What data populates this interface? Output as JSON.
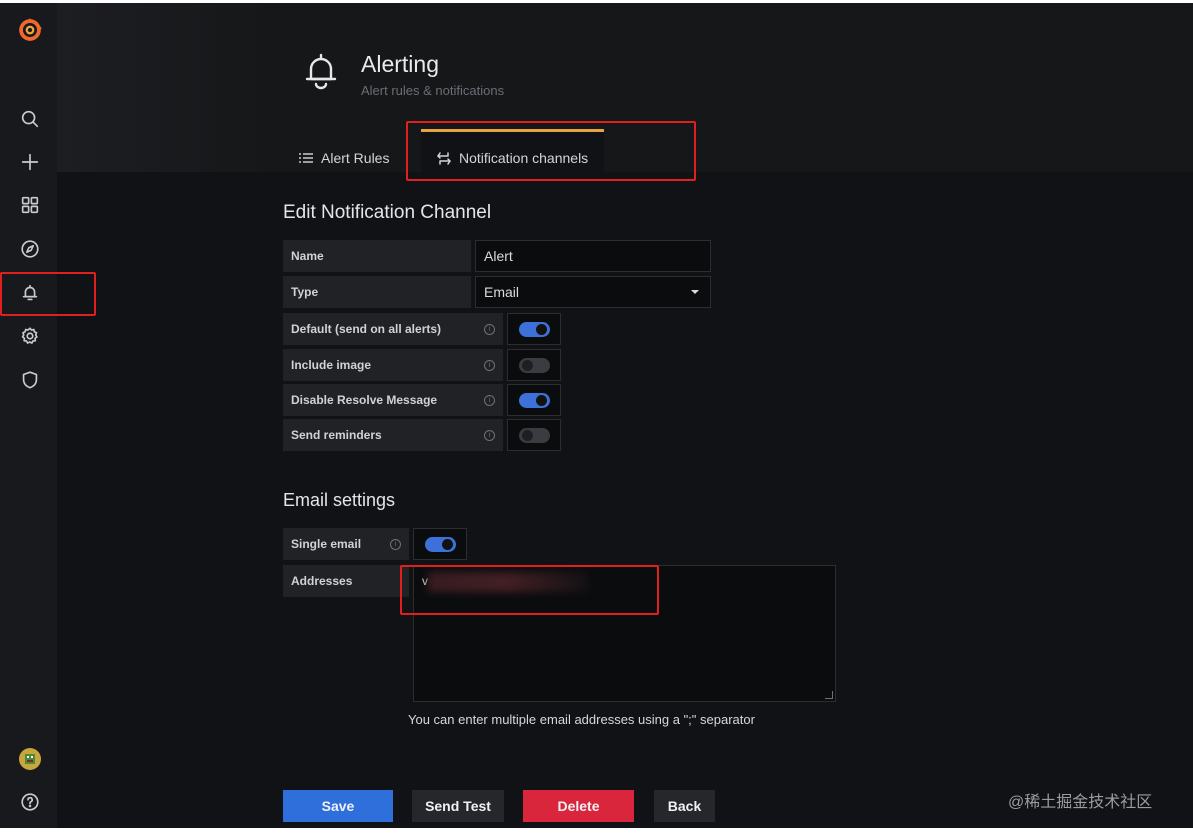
{
  "header": {
    "title": "Alerting",
    "subtitle": "Alert rules & notifications"
  },
  "tabs": [
    {
      "label": "Alert Rules",
      "icon": "list-icon",
      "active": false
    },
    {
      "label": "Notification channels",
      "icon": "channel-icon",
      "active": true
    }
  ],
  "sidebar": {
    "items": [
      "grafana-logo",
      "search-icon",
      "plus-icon",
      "dashboards-icon",
      "explore-compass-icon",
      "alerting-bell-icon",
      "configuration-gear-icon",
      "shield-icon",
      "avatar",
      "help-icon"
    ],
    "active": "alerting-bell-icon"
  },
  "form": {
    "section_title": "Edit Notification Channel",
    "name_label": "Name",
    "name_value": "Alert",
    "type_label": "Type",
    "type_value": "Email",
    "toggles": [
      {
        "label": "Default (send on all alerts)",
        "on": true
      },
      {
        "label": "Include image",
        "on": false
      },
      {
        "label": "Disable Resolve Message",
        "on": true
      },
      {
        "label": "Send reminders",
        "on": false
      }
    ]
  },
  "email": {
    "section_title": "Email settings",
    "single_label": "Single email",
    "single_on": true,
    "addresses_label": "Addresses",
    "addresses_value": "v",
    "hint": "You can enter multiple email addresses using a \";\" separator"
  },
  "buttons": {
    "save": "Save",
    "send_test": "Send Test",
    "delete": "Delete",
    "back": "Back"
  },
  "watermark": "@稀土掘金技术社区",
  "colors": {
    "accent_blue": "#3d71d9",
    "primary": "#2f6fdc",
    "danger": "#d9263c",
    "tab_active_border": "#e8a33d",
    "highlight_box": "#e0201f"
  }
}
